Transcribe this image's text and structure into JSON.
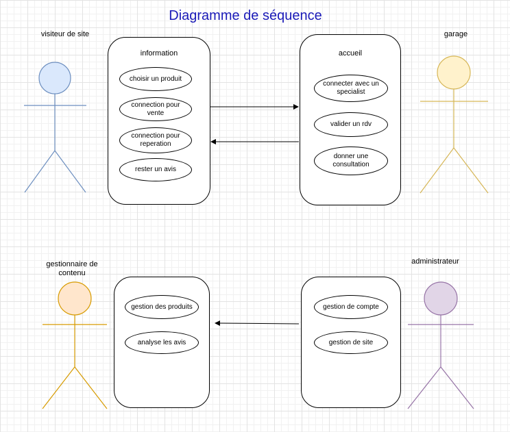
{
  "title": "Diagramme de séquence",
  "actors": {
    "visiteur": {
      "label": "visiteur de site",
      "color": "#6c8ebf",
      "fill": "#dae8fc"
    },
    "garage": {
      "label": "garage",
      "color": "#d6b656",
      "fill": "#fff2cc"
    },
    "gestionnaire": {
      "label": "gestionnaire de contenu",
      "color": "#d79b00",
      "fill": "#ffe6cc"
    },
    "administrateur": {
      "label": "administrateur",
      "color": "#9673a6",
      "fill": "#e1d5e7"
    }
  },
  "boxes": {
    "information": {
      "title": "information",
      "items": [
        "choisir un produit",
        "connection pour vente",
        "connection pour reperation",
        "rester un avis"
      ]
    },
    "accueil": {
      "title": "accueil",
      "items": [
        "connecter avec un specialist",
        "valider un rdv",
        "donner une consultation"
      ]
    },
    "contenu": {
      "title": "",
      "items": [
        "gestion des produits",
        "analyse les avis"
      ]
    },
    "admin": {
      "title": "",
      "items": [
        "gestion de compte",
        "gestion de site"
      ]
    }
  }
}
